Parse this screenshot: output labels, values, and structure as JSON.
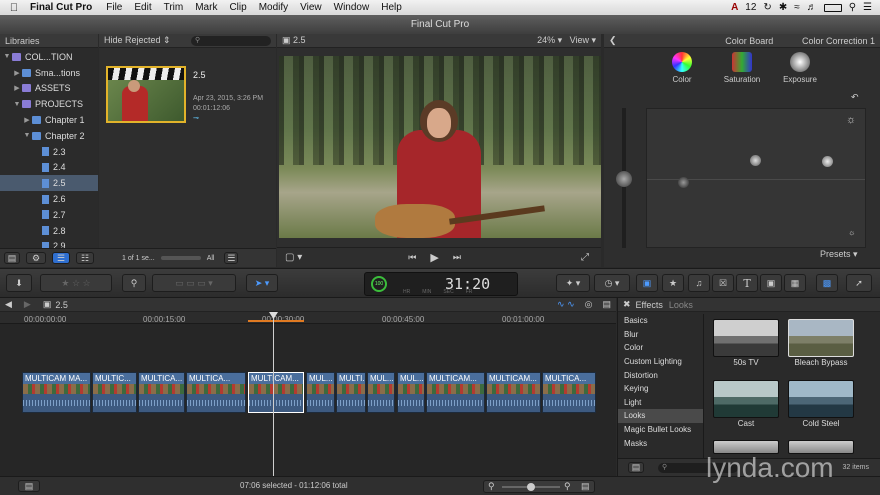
{
  "menubar": {
    "app_name": "Final Cut Pro",
    "items": [
      "File",
      "Edit",
      "Trim",
      "Mark",
      "Clip",
      "Modify",
      "View",
      "Window",
      "Help"
    ],
    "badge": "12"
  },
  "window": {
    "title": "Final Cut Pro"
  },
  "libraries": {
    "header": "Libraries",
    "items": [
      {
        "label": "COL...TION",
        "indent": 0,
        "kind": "library",
        "expanded": true
      },
      {
        "label": "Sma...tions",
        "indent": 1,
        "kind": "folder",
        "expanded": false
      },
      {
        "label": "ASSETS",
        "indent": 1,
        "kind": "event",
        "expanded": false
      },
      {
        "label": "PROJECTS",
        "indent": 1,
        "kind": "event",
        "expanded": true
      },
      {
        "label": "Chapter 1",
        "indent": 2,
        "kind": "folder",
        "expanded": false
      },
      {
        "label": "Chapter 2",
        "indent": 2,
        "kind": "folder",
        "expanded": true
      },
      {
        "label": "2.3",
        "indent": 3,
        "kind": "project"
      },
      {
        "label": "2.4",
        "indent": 3,
        "kind": "project"
      },
      {
        "label": "2.5",
        "indent": 3,
        "kind": "project",
        "selected": true
      },
      {
        "label": "2.6",
        "indent": 3,
        "kind": "project"
      },
      {
        "label": "2.7",
        "indent": 3,
        "kind": "project"
      },
      {
        "label": "2.8",
        "indent": 3,
        "kind": "project"
      },
      {
        "label": "2.9",
        "indent": 3,
        "kind": "project"
      }
    ]
  },
  "browser": {
    "filter": "Hide Rejected",
    "clip_name": "2.5",
    "clip_date": "Apr 23, 2015, 3:26 PM",
    "clip_duration": "00:01:12:06",
    "selection_info": "1 of 1 se...",
    "all_label": "All"
  },
  "viewer": {
    "title": "2.5",
    "zoom": "24%",
    "view_label": "View"
  },
  "color_board": {
    "title": "Color Board",
    "correction": "Color Correction 1",
    "tabs": [
      "Color",
      "Saturation",
      "Exposure"
    ],
    "presets": "Presets"
  },
  "timecode": {
    "display": "31:20",
    "prefix": "100",
    "units": [
      "HR",
      "MIN",
      "SEC",
      "FR"
    ]
  },
  "timeline": {
    "project_name": "2.5",
    "ruler": [
      "00:00:00:00",
      "00:00:15:00",
      "00:00:30:00",
      "00:00:45:00",
      "00:01:00:00"
    ],
    "clips": [
      "MULTICAM MA...",
      "MULTIC...",
      "MULTICA...",
      "MULTICA...",
      "MULTICAM...",
      "MUL...",
      "MULTI...",
      "MUL...",
      "MUL...",
      "MULTICAM...",
      "MULTICAM...",
      "MULTICA..."
    ],
    "status": "07:06 selected - 01:12:06 total"
  },
  "effects": {
    "title": "Effects",
    "subtitle": "Looks",
    "categories": [
      "Basics",
      "Blur",
      "Color",
      "Custom Lighting",
      "Distortion",
      "Keying",
      "Light",
      "Looks",
      "Magic Bullet Looks",
      "Masks"
    ],
    "selected_category": "Looks",
    "looks": [
      "50s TV",
      "Bleach Bypass",
      "Cast",
      "Cold Steel"
    ],
    "count": "32 items"
  },
  "watermark": "lynda.com"
}
